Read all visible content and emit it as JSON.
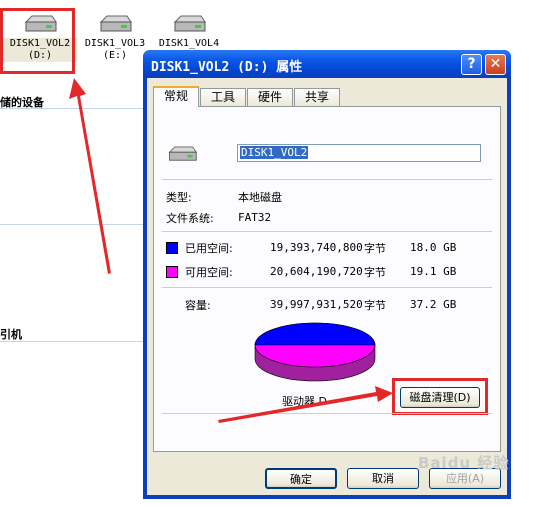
{
  "desktop": {
    "drives": [
      {
        "name": "DISK1_VOL2",
        "letter": "(D:)"
      },
      {
        "name": "DISK1_VOL3",
        "letter": "(E:)"
      },
      {
        "name": "DISK1_VOL4",
        "letter": ""
      }
    ],
    "side_headings": [
      "储的设备",
      "引机"
    ]
  },
  "dialog": {
    "title": "DISK1_VOL2 (D:) 属性",
    "help_label": "?",
    "close_label": "✕",
    "tabs": [
      "常规",
      "工具",
      "硬件",
      "共享"
    ],
    "volume_label_value": "DISK1_VOL2",
    "type_label": "类型:",
    "type_value": "本地磁盘",
    "fs_label": "文件系统:",
    "fs_value": "FAT32",
    "used": {
      "label": "已用空间:",
      "bytes": "19,393,740,800",
      "unit": "字节",
      "size": "18.0 GB",
      "color": "#0000ff"
    },
    "free": {
      "label": "可用空间:",
      "bytes": "20,604,190,720",
      "unit": "字节",
      "size": "19.1 GB",
      "color": "#ff00ff"
    },
    "capacity": {
      "label": "容量:",
      "bytes": "39,997,931,520",
      "unit": "字节",
      "size": "37.2 GB"
    },
    "drive_caption": "驱动器 D",
    "cleanup_button": "磁盘清理(D)",
    "ok_button": "确定",
    "cancel_button": "取消",
    "apply_button": "应用(A)"
  },
  "watermark": "Baidu 经验"
}
